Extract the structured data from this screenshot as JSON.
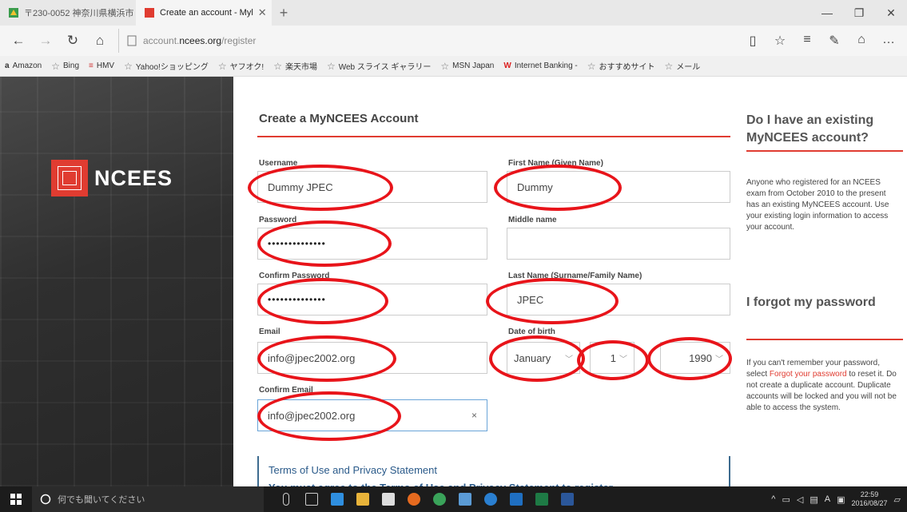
{
  "browser": {
    "tabs": [
      {
        "title": "〒230-0052 神奈川県横浜市",
        "active": false
      },
      {
        "title": "Create an account - Myl",
        "active": true
      }
    ],
    "url_prefix": "account.",
    "url_domain": "ncees.org",
    "url_path": "/register",
    "favorites": [
      "Amazon",
      "Bing",
      "HMV",
      "Yahoo!ショッピング",
      "ヤフオク!",
      "楽天市場",
      "Web スライス ギャラリー",
      "MSN Japan",
      "Internet Banking -",
      "おすすめサイト",
      "メール"
    ]
  },
  "brand": {
    "name": "NCEES",
    "color": "#e03c31"
  },
  "form": {
    "title": "Create a MyNCEES Account",
    "username_label": "Username",
    "username_value": "Dummy JPEC",
    "first_name_label": "First Name (Given Name)",
    "first_name_value": "Dummy",
    "password_label": "Password",
    "password_value": "••••••••••••••",
    "middle_name_label": "Middle name",
    "middle_name_value": "",
    "confirm_password_label": "Confirm Password",
    "confirm_password_value": "••••••••••••••",
    "last_name_label": "Last Name (Surname/Family Name)",
    "last_name_value": "JPEC",
    "email_label": "Email",
    "email_value": "info@jpec2002.org",
    "dob_label": "Date of birth",
    "dob_month": "January",
    "dob_day": "1",
    "dob_year": "1990",
    "confirm_email_label": "Confirm Email",
    "confirm_email_value": "info@jpec2002.org",
    "clear_glyph": "×"
  },
  "terms": {
    "heading": "Terms of Use and Privacy Statement",
    "body": "You must agree to the Terms of Use and Privacy Statement to register."
  },
  "sidebar": {
    "existing_heading": "Do I have an existing MyNCEES account?",
    "existing_text": "Anyone who registered for an NCEES exam from October 2010 to the present has an existing MyNCEES account. Use your existing login information to access your account.",
    "forgot_heading": "I forgot my password",
    "forgot_text_pre": "If you can't remember your password, select ",
    "forgot_link": "Forgot your password",
    "forgot_text_post": " to reset it. Do not create a duplicate account. Duplicate accounts will be locked and you will not be able to access the system."
  },
  "taskbar": {
    "search_placeholder": "何でも聞いてください",
    "ime_mode": "A",
    "time": "22:59",
    "date": "2016/08/27"
  }
}
